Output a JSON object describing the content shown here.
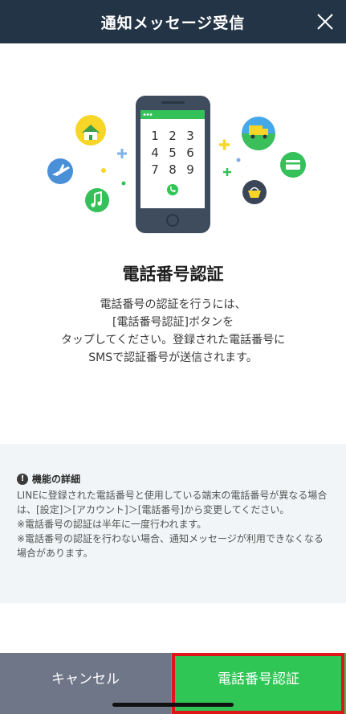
{
  "header": {
    "title": "通知メッセージ受信",
    "close_icon": "close-icon"
  },
  "hero": {
    "keypad": [
      "1",
      "2",
      "3",
      "4",
      "5",
      "6",
      "7",
      "8",
      "9"
    ],
    "icons": [
      "house-icon",
      "airplane-icon",
      "music-note-icon",
      "truck-icon",
      "credit-card-icon",
      "shopping-basket-icon",
      "phone-call-icon"
    ]
  },
  "content": {
    "heading": "電話番号認証",
    "description_lines": [
      "電話番号の認証を行うには、",
      "[電話番号認証]ボタンを",
      "タップしてください。登録された電話番号に",
      "SMSで認証番号が送信されます。"
    ]
  },
  "details": {
    "title": "機能の詳細",
    "info_icon": "!",
    "paragraphs": [
      "LINEに登録された電話番号と使用している端末の電話番号が異なる場合は、[設定]＞[アカウント]＞[電話番号]から変更してください。",
      "※電話番号の認証は半年に一度行われます。",
      "※電話番号の認証を行わない場合、通知メッセージが利用できなくなる場合があります。"
    ]
  },
  "footer": {
    "cancel_label": "キャンセル",
    "verify_label": "電話番号認証"
  },
  "colors": {
    "header_bg": "#243447",
    "accent_green": "#2fc655",
    "cancel_bg": "#6e7687",
    "details_bg": "#f1f5f7",
    "highlight_red": "#e0151a"
  }
}
